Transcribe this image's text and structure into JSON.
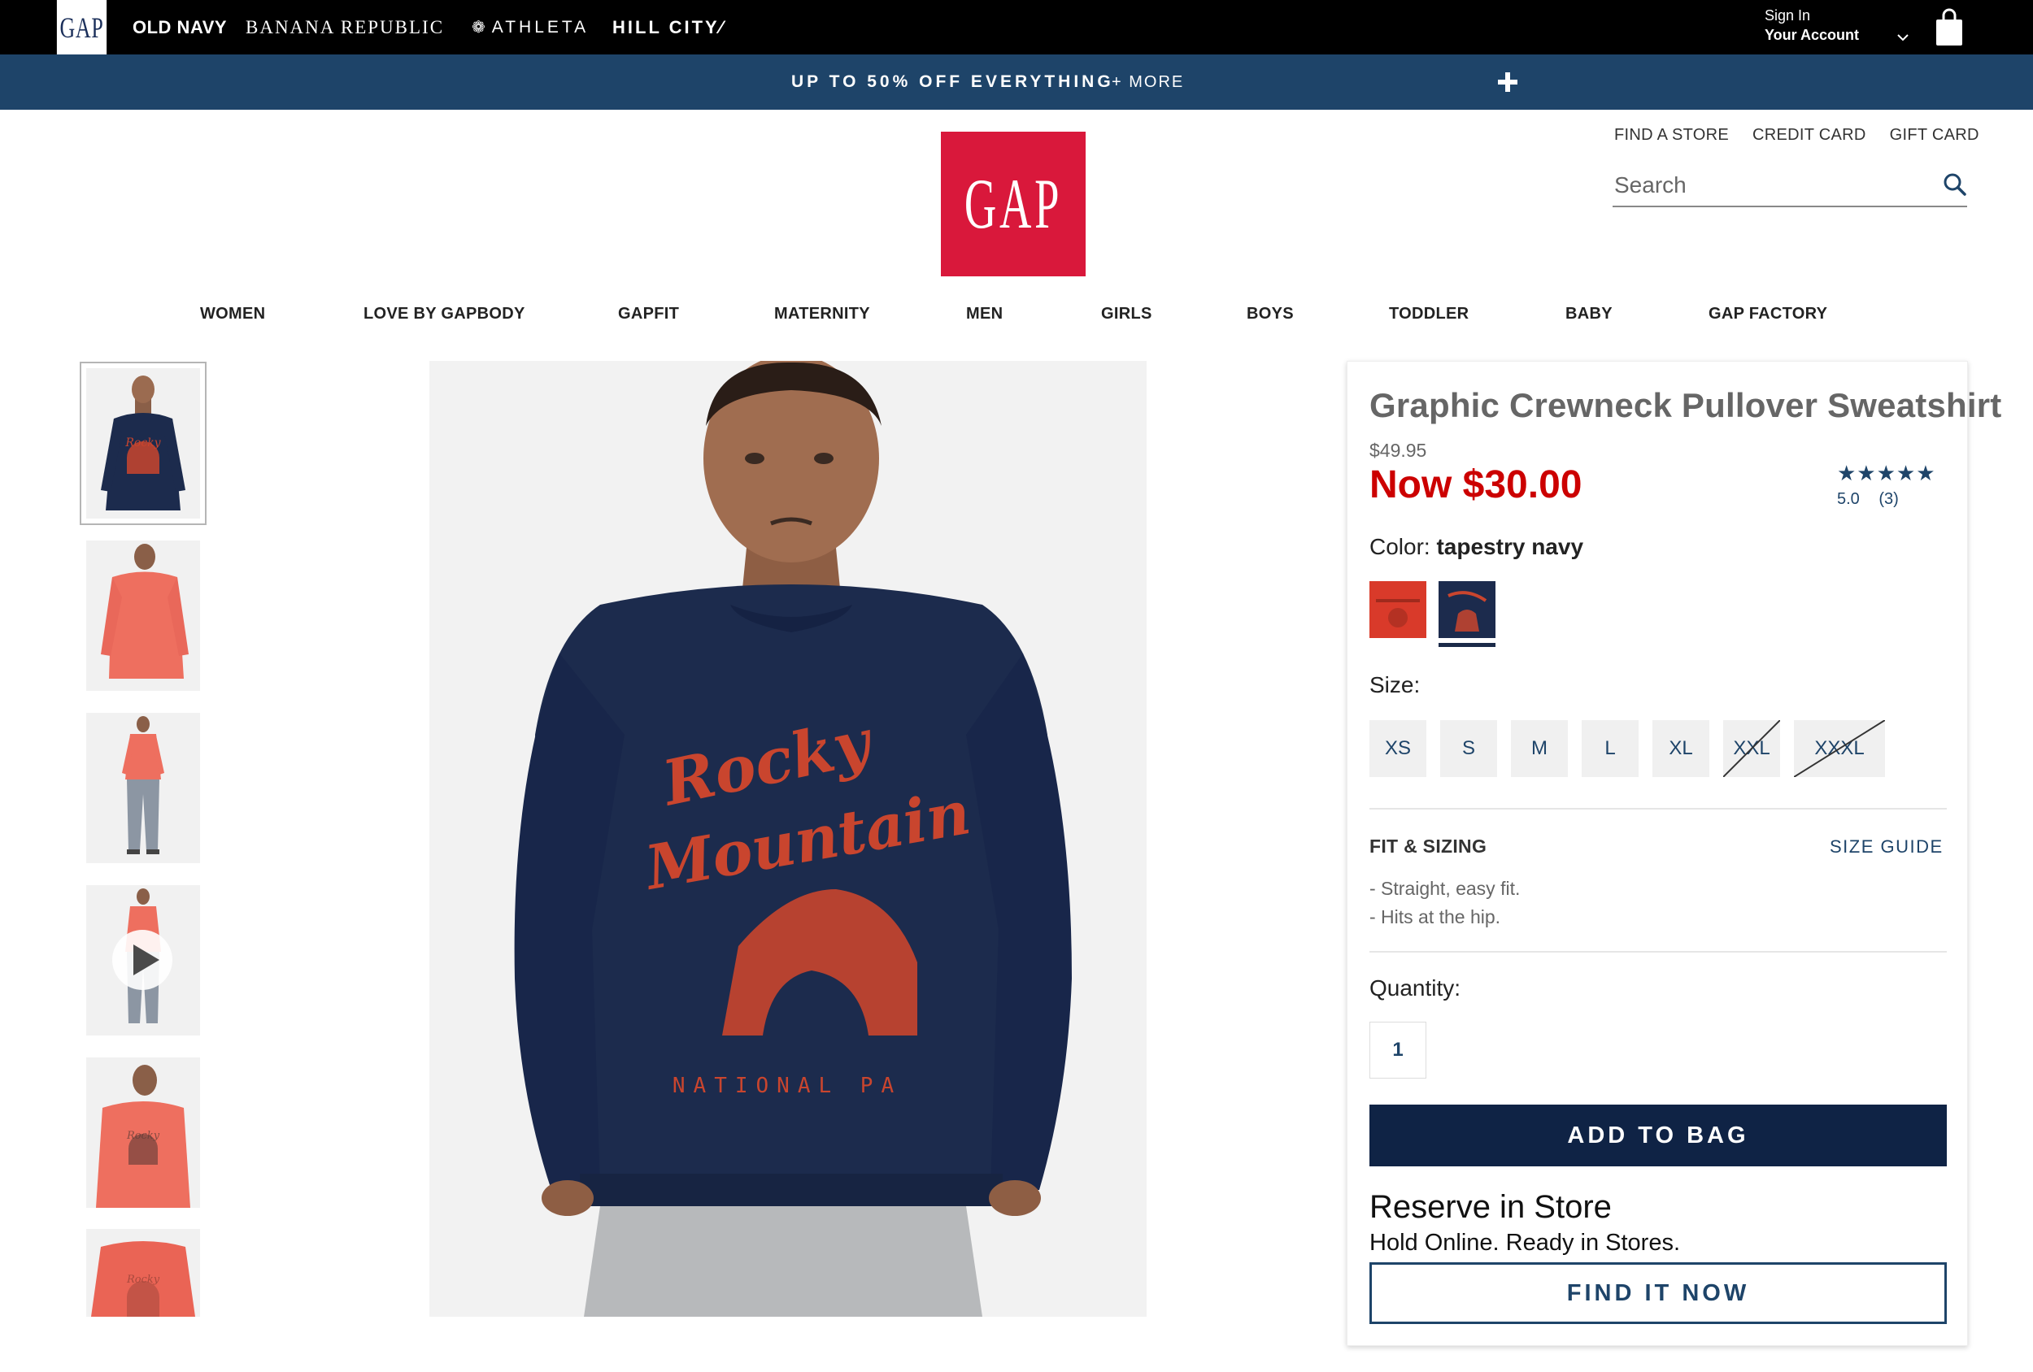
{
  "brand_bar": {
    "gap": "GAP",
    "old_navy": "OLD NAVY",
    "banana_republic": "BANANA REPUBLIC",
    "athleta": "ATHLETA",
    "hill_city": "HILL CITY⁄",
    "sign_in": "Sign In",
    "your_account": "Your Account"
  },
  "promo": {
    "text": "UP TO 50% OFF EVERYTHING",
    "more": "+ MORE"
  },
  "header": {
    "logo": "GAP",
    "links": [
      "FIND A STORE",
      "CREDIT CARD",
      "GIFT CARD"
    ],
    "search_placeholder": "Search"
  },
  "nav": {
    "items": [
      "WOMEN",
      "LOVE BY GAPBODY",
      "GAPFIT",
      "MATERNITY",
      "MEN",
      "GIRLS",
      "BOYS",
      "TODDLER",
      "BABY",
      "GAP FACTORY"
    ]
  },
  "gallery": {
    "main_graphic_line1": "Rocky",
    "main_graphic_line2": "Mountain",
    "main_graphic_line3": "NATIONAL PA"
  },
  "product": {
    "title": "Graphic Crewneck Pullover Sweatshirt",
    "original_price": "$49.95",
    "sale_price": "Now $30.00",
    "rating_stars": "★★★★★",
    "rating_value": "5.0",
    "review_count": "(3)",
    "color_label": "Color:",
    "color_name": "tapestry navy",
    "size_label": "Size:",
    "sizes": [
      "XS",
      "S",
      "M",
      "L",
      "XL",
      "XXL",
      "XXXL"
    ],
    "unavailable_sizes": [
      "XXL",
      "XXXL"
    ],
    "fit_heading": "FIT & SIZING",
    "size_guide": "SIZE GUIDE",
    "fit_details": [
      "- Straight, easy fit.",
      "- Hits at the hip."
    ],
    "quantity_label": "Quantity:",
    "quantity": "1",
    "add_to_bag": "ADD TO BAG",
    "reserve_title": "Reserve in Store",
    "reserve_subtitle": "Hold Online. Ready in Stores.",
    "find_it_now": "FIND IT NOW"
  },
  "colors": {
    "brand_black": "#000000",
    "promo_navy": "#1e4469",
    "gap_red": "#d9183b",
    "sale_red": "#cc0000",
    "button_navy": "#0f2345",
    "sweatshirt_navy": "#1c2b4d",
    "sweatshirt_coral": "#ee6f5f",
    "graphic_orange": "#c9452e"
  }
}
